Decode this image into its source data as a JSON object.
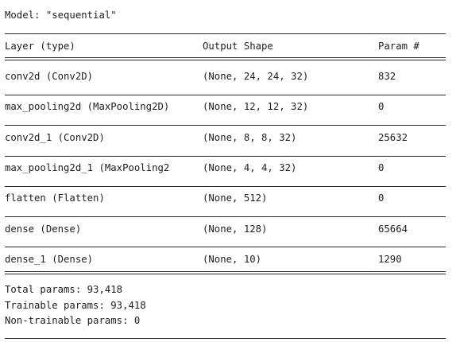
{
  "model_title": "Model: \"sequential\"",
  "headers": {
    "layer": "Layer (type)",
    "output_shape": "Output Shape",
    "params": "Param #"
  },
  "layers": [
    {
      "layer": "conv2d (Conv2D)",
      "output_shape": "(None, 24, 24, 32)",
      "params": "832"
    },
    {
      "layer": "max_pooling2d (MaxPooling2D)",
      "output_shape": "(None, 12, 12, 32)",
      "params": "0"
    },
    {
      "layer": "conv2d_1 (Conv2D)",
      "output_shape": "(None, 8, 8, 32)",
      "params": "25632"
    },
    {
      "layer": "max_pooling2d_1 (MaxPooling2",
      "output_shape": "(None, 4, 4, 32)",
      "params": "0"
    },
    {
      "layer": "flatten (Flatten)",
      "output_shape": "(None, 512)",
      "params": "0"
    },
    {
      "layer": "dense (Dense)",
      "output_shape": "(None, 128)",
      "params": "65664"
    },
    {
      "layer": "dense_1 (Dense)",
      "output_shape": "(None, 10)",
      "params": "1290"
    }
  ],
  "totals": {
    "total": "Total params: 93,418",
    "trainable": "Trainable params: 93,418",
    "non_trainable": "Non-trainable params: 0"
  }
}
